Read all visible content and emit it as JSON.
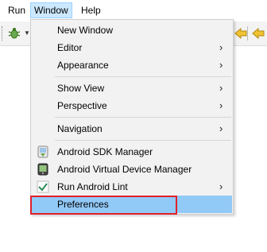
{
  "menubar": {
    "items": [
      {
        "label": "Run"
      },
      {
        "label": "Window"
      },
      {
        "label": "Help"
      }
    ]
  },
  "toolbar": {
    "icons": [
      "debug-bug-icon",
      "dropdown-arrow-icon",
      "back-arrow-icon",
      "forward-arrow-icon"
    ]
  },
  "window_menu": {
    "groups": [
      [
        {
          "label": "New Window",
          "submenu": false
        },
        {
          "label": "Editor",
          "submenu": true
        },
        {
          "label": "Appearance",
          "submenu": true
        }
      ],
      [
        {
          "label": "Show View",
          "submenu": true
        },
        {
          "label": "Perspective",
          "submenu": true
        }
      ],
      [
        {
          "label": "Navigation",
          "submenu": true
        }
      ],
      [
        {
          "label": "Android SDK Manager",
          "submenu": false,
          "icon": "android-sdk-icon"
        },
        {
          "label": "Android Virtual Device Manager",
          "submenu": false,
          "icon": "android-avd-icon"
        },
        {
          "label": "Run Android Lint",
          "submenu": true,
          "icon": "checkmark-icon"
        },
        {
          "label": "Preferences",
          "submenu": false,
          "highlighted": true
        }
      ]
    ],
    "submenu_glyph": "›"
  },
  "colors": {
    "highlight": "#91c9f7",
    "menubar_active": "#cce8ff",
    "callout_border": "#e0202b"
  }
}
